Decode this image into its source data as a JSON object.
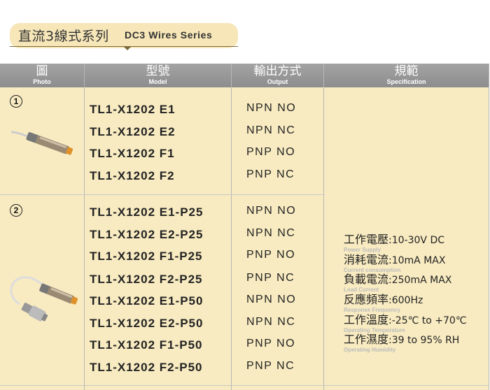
{
  "title": {
    "zh": "直流3線式系列",
    "en": "DC3 Wires Series"
  },
  "headers": [
    {
      "zh": "圖",
      "en": "Photo"
    },
    {
      "zh": "型號",
      "en": "Model"
    },
    {
      "zh": "輸出方式",
      "en": "Output"
    },
    {
      "zh": "規範",
      "en": "Specification"
    }
  ],
  "groups": [
    {
      "number": "1",
      "rows": [
        {
          "model": "TL1-X1202 E1",
          "output": "NPN NO"
        },
        {
          "model": "TL1-X1202 E2",
          "output": "NPN NC"
        },
        {
          "model": "TL1-X1202 F1",
          "output": "PNP NO"
        },
        {
          "model": "TL1-X1202 F2",
          "output": "PNP NC"
        }
      ]
    },
    {
      "number": "2",
      "rows": [
        {
          "model": "TL1-X1202 E1-P25",
          "output": "NPN NO"
        },
        {
          "model": "TL1-X1202 E2-P25",
          "output": "NPN NC"
        },
        {
          "model": "TL1-X1202 F1-P25",
          "output": "PNP NO"
        },
        {
          "model": "TL1-X1202 F2-P25",
          "output": "PNP NC"
        },
        {
          "model": "TL1-X1202 E1-P50",
          "output": "NPN NO"
        },
        {
          "model": "TL1-X1202 E2-P50",
          "output": "NPN NC"
        },
        {
          "model": "TL1-X1202 F1-P50",
          "output": "PNP NO"
        },
        {
          "model": "TL1-X1202 F2-P50",
          "output": "PNP NC"
        }
      ]
    }
  ],
  "specs": [
    {
      "label": "工作電壓",
      "value": ":10-30V DC",
      "sub": "Power Supply"
    },
    {
      "label": "消耗電流",
      "value": ":10mA MAX",
      "sub": "Current consumption"
    },
    {
      "label": "負載電流",
      "value": ":250mA MAX",
      "sub": "Load Current"
    },
    {
      "label": "反應頻率",
      "value": ":600Hz",
      "sub": "Response Frequency"
    },
    {
      "label": "工作溫度",
      "value": ":-25℃ to +70℃",
      "sub": "Operating Temperature"
    },
    {
      "label": "工作濕度",
      "value": ":39 to 95% RH",
      "sub": "Operating Humidity"
    }
  ]
}
